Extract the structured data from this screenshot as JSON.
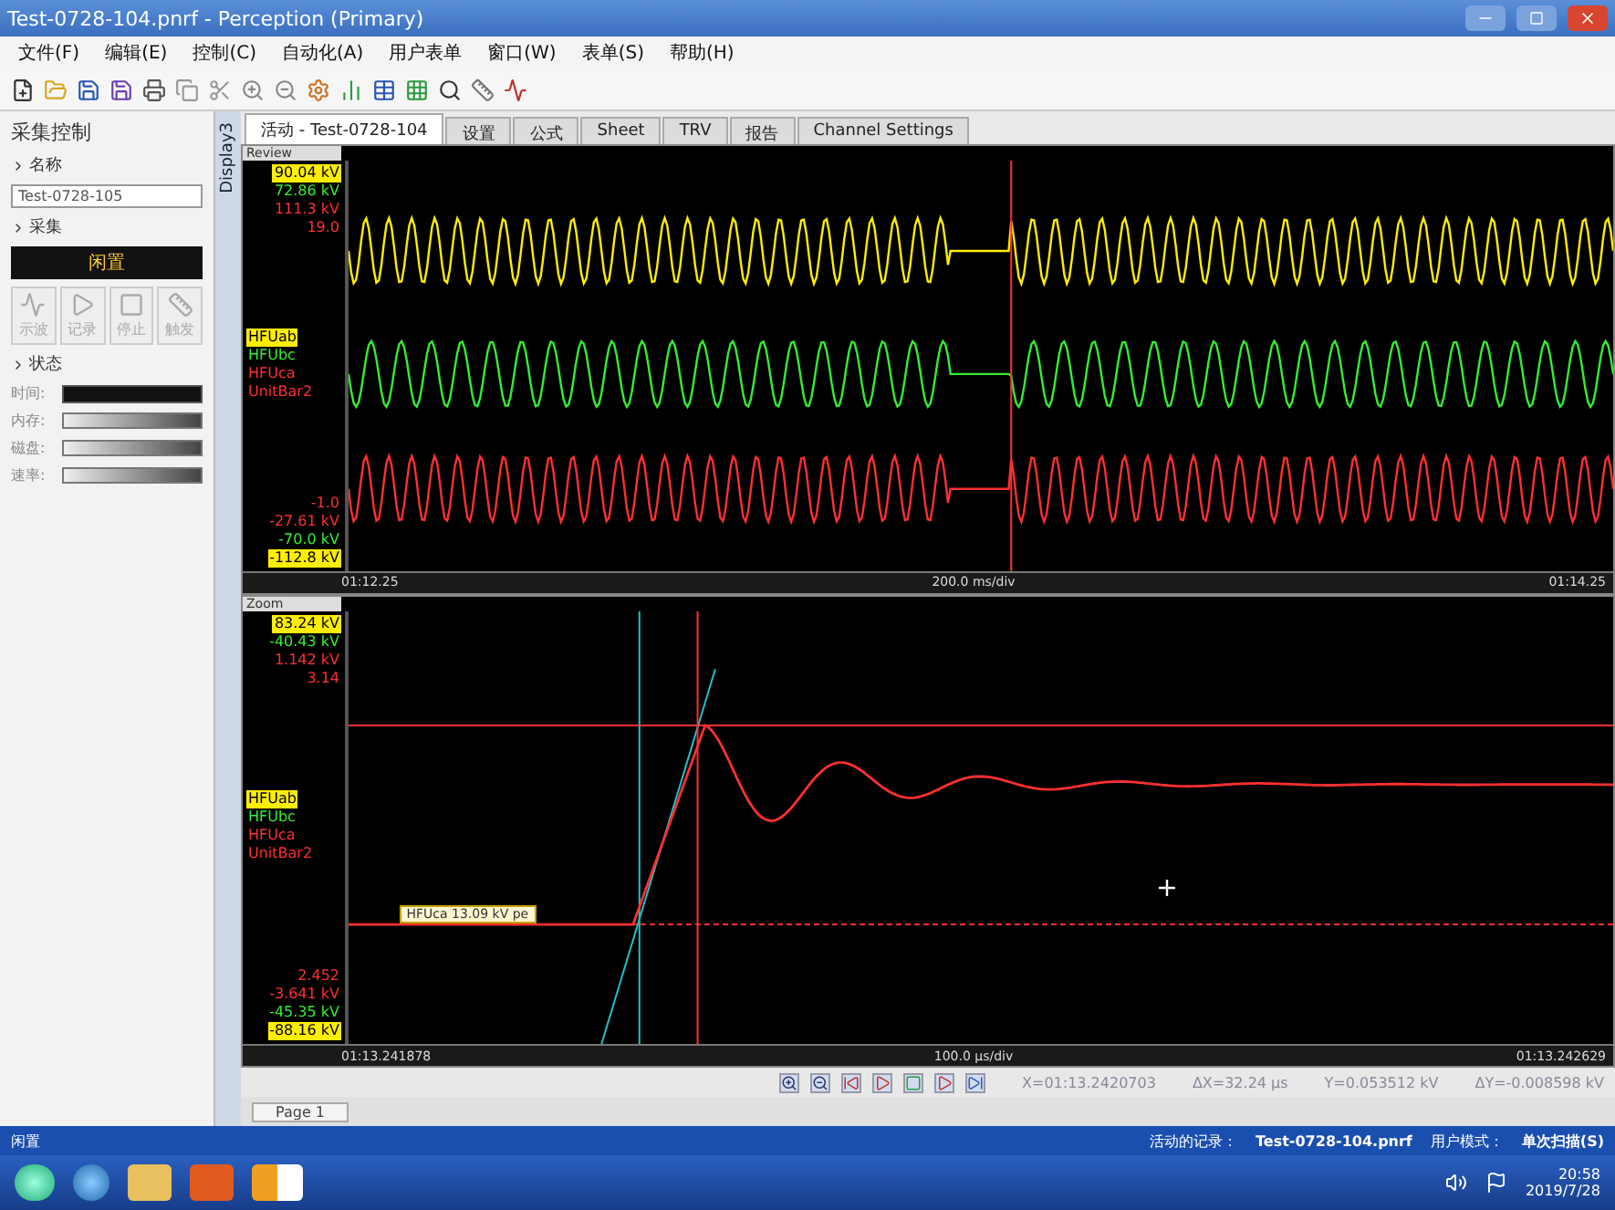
{
  "window": {
    "title": "Test-0728-104.pnrf - Perception (Primary)"
  },
  "menu": [
    "文件(F)",
    "编辑(E)",
    "控制(C)",
    "自动化(A)",
    "用户表单",
    "窗口(W)",
    "表单(S)",
    "帮助(H)"
  ],
  "left_panel": {
    "title": "采集控制",
    "name_label": "名称",
    "name_value": "Test-0728-105",
    "acquisition_label": "采集",
    "status": "闲置",
    "buttons": [
      {
        "label": "示波",
        "disabled": true
      },
      {
        "label": "记录",
        "disabled": true
      },
      {
        "label": "停止",
        "disabled": true
      },
      {
        "label": "触发",
        "disabled": true
      }
    ],
    "state_label": "状态",
    "state_rows": [
      {
        "label": "时间:",
        "kind": "field"
      },
      {
        "label": "内存:",
        "kind": "meter",
        "level": 1
      },
      {
        "label": "磁盘:",
        "kind": "meter",
        "level": 1
      },
      {
        "label": "速率:",
        "kind": "meter",
        "level": 1
      }
    ]
  },
  "side_tab": "Display3",
  "tabs": [
    {
      "label": "活动 - Test-0728-104",
      "selected": true
    },
    {
      "label": "设置",
      "selected": false
    },
    {
      "label": "公式",
      "selected": false
    },
    {
      "label": "Sheet",
      "selected": false
    },
    {
      "label": "TRV",
      "selected": false
    },
    {
      "label": "报告",
      "selected": false
    },
    {
      "label": "Channel Settings",
      "selected": false
    }
  ],
  "review": {
    "title": "Review",
    "top_readouts": [
      {
        "text": "90.04 kV",
        "color": "#ffee00",
        "highlighted": true
      },
      {
        "text": "72.86 kV",
        "color": "#33ee33",
        "highlighted": false
      },
      {
        "text": "111.3 kV",
        "color": "#ff3030",
        "highlighted": false
      },
      {
        "text": "19.0",
        "color": "#ff3030",
        "highlighted": false
      }
    ],
    "channels": [
      {
        "name": "HFUab",
        "color": "#ffee00",
        "highlighted": true
      },
      {
        "name": "HFUbc",
        "color": "#33ee33",
        "highlighted": false
      },
      {
        "name": "HFUca",
        "color": "#ff3030",
        "highlighted": false
      },
      {
        "name": "UnitBar2",
        "color": "#ff3030",
        "highlighted": false
      }
    ],
    "bottom_readouts": [
      {
        "text": "-1.0",
        "color": "#ff3030",
        "highlighted": false
      },
      {
        "text": "-27.61 kV",
        "color": "#ff3030",
        "highlighted": false
      },
      {
        "text": "-70.0 kV",
        "color": "#33ee33",
        "highlighted": false
      },
      {
        "text": "-112.8 kV",
        "color": "#ffee00",
        "highlighted": true
      }
    ],
    "time_start": "01:12.25",
    "scale": "200.0 ms/div",
    "time_end": "01:14.25"
  },
  "zoom": {
    "title": "Zoom",
    "top_readouts": [
      {
        "text": "83.24 kV",
        "color": "#ffee00",
        "highlighted": true
      },
      {
        "text": "-40.43 kV",
        "color": "#33ee33",
        "highlighted": false
      },
      {
        "text": "1.142 kV",
        "color": "#ff3030",
        "highlighted": false
      },
      {
        "text": "3.14",
        "color": "#ff3030",
        "highlighted": false
      }
    ],
    "channels": [
      {
        "name": "HFUab",
        "color": "#ffee00",
        "highlighted": true
      },
      {
        "name": "HFUbc",
        "color": "#33ee33",
        "highlighted": false
      },
      {
        "name": "HFUca",
        "color": "#ff3030",
        "highlighted": false
      },
      {
        "name": "UnitBar2",
        "color": "#ff3030",
        "highlighted": false
      }
    ],
    "bottom_readouts": [
      {
        "text": "2.452",
        "color": "#ff3030",
        "highlighted": false
      },
      {
        "text": "-3.641 kV",
        "color": "#ff3030",
        "highlighted": false
      },
      {
        "text": "-45.35 kV",
        "color": "#33ee33",
        "highlighted": false
      },
      {
        "text": "-88.16 kV",
        "color": "#ffee00",
        "highlighted": true
      }
    ],
    "cursor_label": "HFUca 13.09 kV pe",
    "time_start": "01:13.241878",
    "scale": "100.0 µs/div",
    "time_end": "01:13.242629"
  },
  "cursor_readout": {
    "x": "X=01:13.2420703",
    "dx": "ΔX=32.24 µs",
    "y": "Y=0.053512 kV",
    "dy": "ΔY=-0.008598 kV"
  },
  "page": "Page 1",
  "status_bar": {
    "state": "闲置",
    "active_label": "活动的记录：",
    "file": "Test-0728-104.pnrf",
    "mode": "用户模式：",
    "scan": "单次扫描(S)"
  },
  "taskbar": {
    "time": "20:58",
    "date": "2019/7/28"
  }
}
